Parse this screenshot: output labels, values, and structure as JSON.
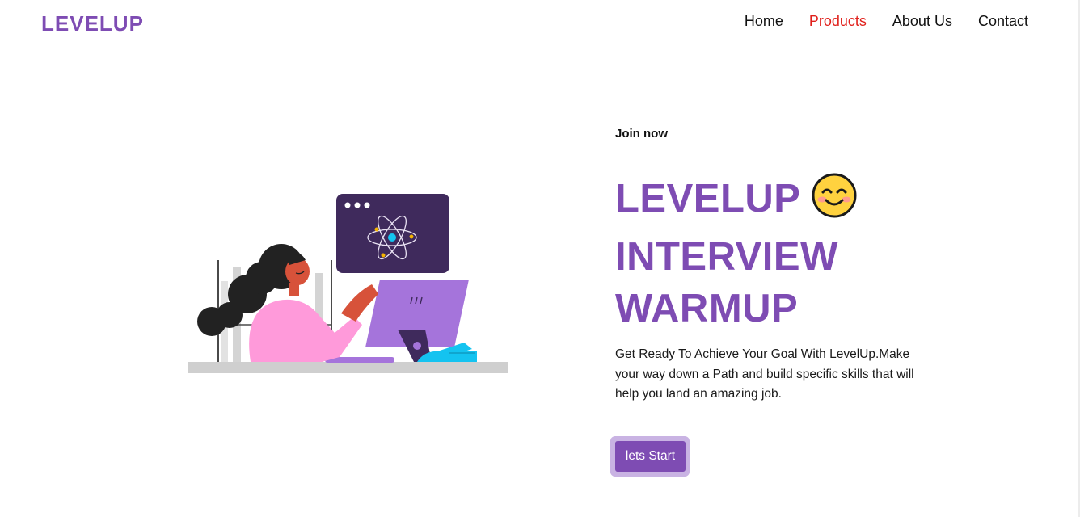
{
  "brand": {
    "name": "LEVELUP"
  },
  "nav": {
    "items": [
      {
        "label": "Home"
      },
      {
        "label": "Products",
        "active": true
      },
      {
        "label": "About Us"
      },
      {
        "label": "Contact"
      }
    ]
  },
  "hero": {
    "eyebrow": "Join now",
    "headline": [
      "LEVELUP",
      "INTERVIEW",
      "WARMUP"
    ],
    "headline_emoji": "smiling-face-icon",
    "description": "Get Ready To Achieve Your Goal With LevelUp.Make your way down a Path and build specific skills that will help you land an amazing job.",
    "cta_label": "lets Start"
  },
  "colors": {
    "brand": "#7e4cb3",
    "nav_active": "#e0201b",
    "text": "#111111",
    "button_ring": "#c9b3e3"
  }
}
